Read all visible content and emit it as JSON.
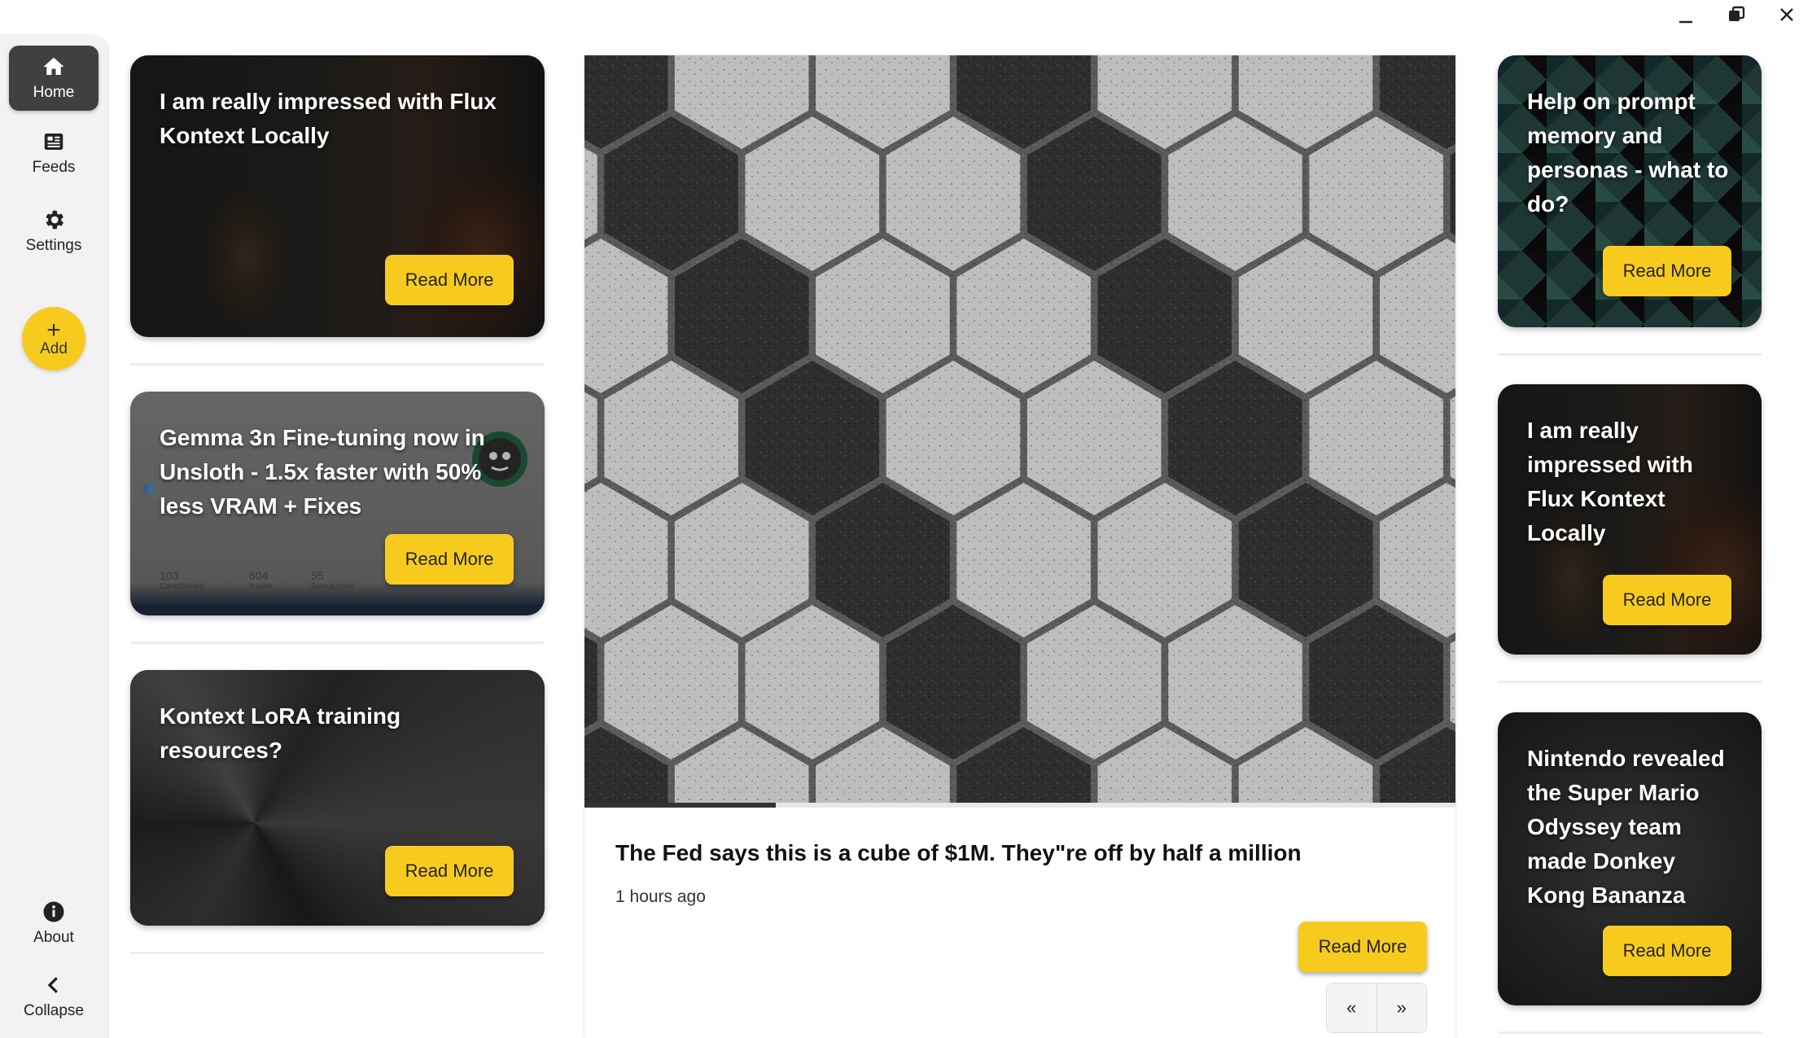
{
  "window": {
    "minimize_icon": "minimize-icon",
    "restore_icon": "restore-icon",
    "close_icon": "close-icon"
  },
  "sidebar": {
    "items": [
      {
        "label": "Home",
        "icon": "home-icon",
        "active": true
      },
      {
        "label": "Feeds",
        "icon": "feeds-icon",
        "active": false
      },
      {
        "label": "Settings",
        "icon": "gear-icon",
        "active": false
      }
    ],
    "add": {
      "plus": "+",
      "label": "Add"
    },
    "about": {
      "label": "About",
      "icon": "info-icon"
    },
    "collapse": {
      "label": "Collapse",
      "icon": "chevron-left-icon"
    }
  },
  "left_cards": [
    {
      "title": "I am really impressed with Flux Kontext Locally",
      "button": "Read More"
    },
    {
      "title": "Gemma 3n Fine-tuning now in Unsloth - 1.5x faster with 50% less VRAM + Fixes",
      "button": "Read More",
      "overlay": {
        "contributors": "103",
        "contributors_label": "Contributors",
        "issues": "604",
        "issues_label": "Issues",
        "discussions": "55",
        "discussions_label": "Discussions"
      }
    },
    {
      "title": "Kontext LoRA training resources?",
      "button": "Read More"
    }
  ],
  "hero": {
    "title": "The Fed says this is a cube of $1M. They\"re off by half a million",
    "time": "1 hours ago",
    "button": "Read More",
    "progress": 0.22,
    "prev": "«",
    "next": "»"
  },
  "right_cards": [
    {
      "title": "Help on prompt memory and personas - what to do?",
      "button": "Read More"
    },
    {
      "title": "I am really impressed with Flux Kontext Locally",
      "button": "Read More"
    },
    {
      "title": "Nintendo revealed the Super Mario Odyssey team made Donkey Kong Bananza",
      "button": "Read More"
    }
  ],
  "colors": {
    "accent": "#f7cb1e",
    "sidebar_bg": "#f2f2f2",
    "active_nav": "#404040"
  }
}
